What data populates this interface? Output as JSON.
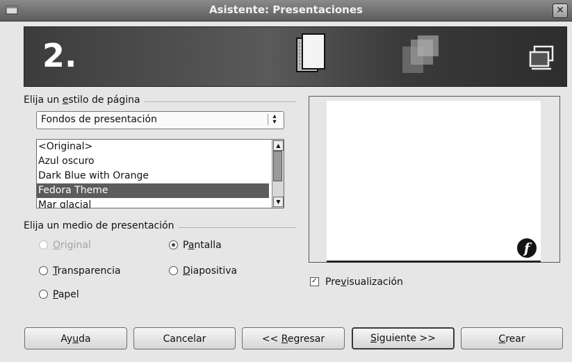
{
  "window": {
    "title": "Asistente: Presentaciones",
    "close_glyph": "✕"
  },
  "banner": {
    "step_number": "2.",
    "icons": [
      "page-icon",
      "layers-icon",
      "monitor-icon"
    ]
  },
  "page_style": {
    "group_label_pre": "Elija un ",
    "group_label_mnemonic": "e",
    "group_label_post": "stilo de página",
    "dropdown_value": "Fondos de presentación",
    "items": [
      {
        "label": "<Original>",
        "selected": false
      },
      {
        "label": "Azul oscuro",
        "selected": false
      },
      {
        "label": "Dark Blue with Orange",
        "selected": false
      },
      {
        "label": "Fedora Theme",
        "selected": true
      },
      {
        "label": "Mar glacial",
        "selected": false
      }
    ]
  },
  "medium": {
    "group_label": "Elija un medio de presentación",
    "options": {
      "original": {
        "mnemonic": "O",
        "rest": "riginal",
        "enabled": false,
        "checked": false
      },
      "pantalla": {
        "pre": "P",
        "mnemonic": "a",
        "rest": "ntalla",
        "enabled": true,
        "checked": true
      },
      "transparencia": {
        "mnemonic": "T",
        "rest": "ransparencia",
        "enabled": true,
        "checked": false
      },
      "diapositiva": {
        "mnemonic": "D",
        "rest": "iapositiva",
        "enabled": true,
        "checked": false
      },
      "papel": {
        "mnemonic": "P",
        "rest": "apel",
        "enabled": true,
        "checked": false
      }
    }
  },
  "preview": {
    "checkbox_pre": "Pre",
    "checkbox_mnemonic": "v",
    "checkbox_post": "isualización",
    "checked": true,
    "check_glyph": "✓",
    "logo_glyph": "f"
  },
  "buttons": {
    "help": {
      "pre": "Ay",
      "mnemonic": "u",
      "post": "da"
    },
    "cancel": {
      "label": "Cancelar"
    },
    "back": {
      "pre": "<< ",
      "mnemonic": "R",
      "post": "egresar"
    },
    "next": {
      "pre": "",
      "mnemonic": "S",
      "post": "iguiente >>"
    },
    "create": {
      "pre": "",
      "mnemonic": "C",
      "post": "rear"
    }
  },
  "colors": {
    "selection": "#5c5c5c",
    "titlebar": "#6e6e6e",
    "dialog_bg": "#e6e6e6"
  }
}
